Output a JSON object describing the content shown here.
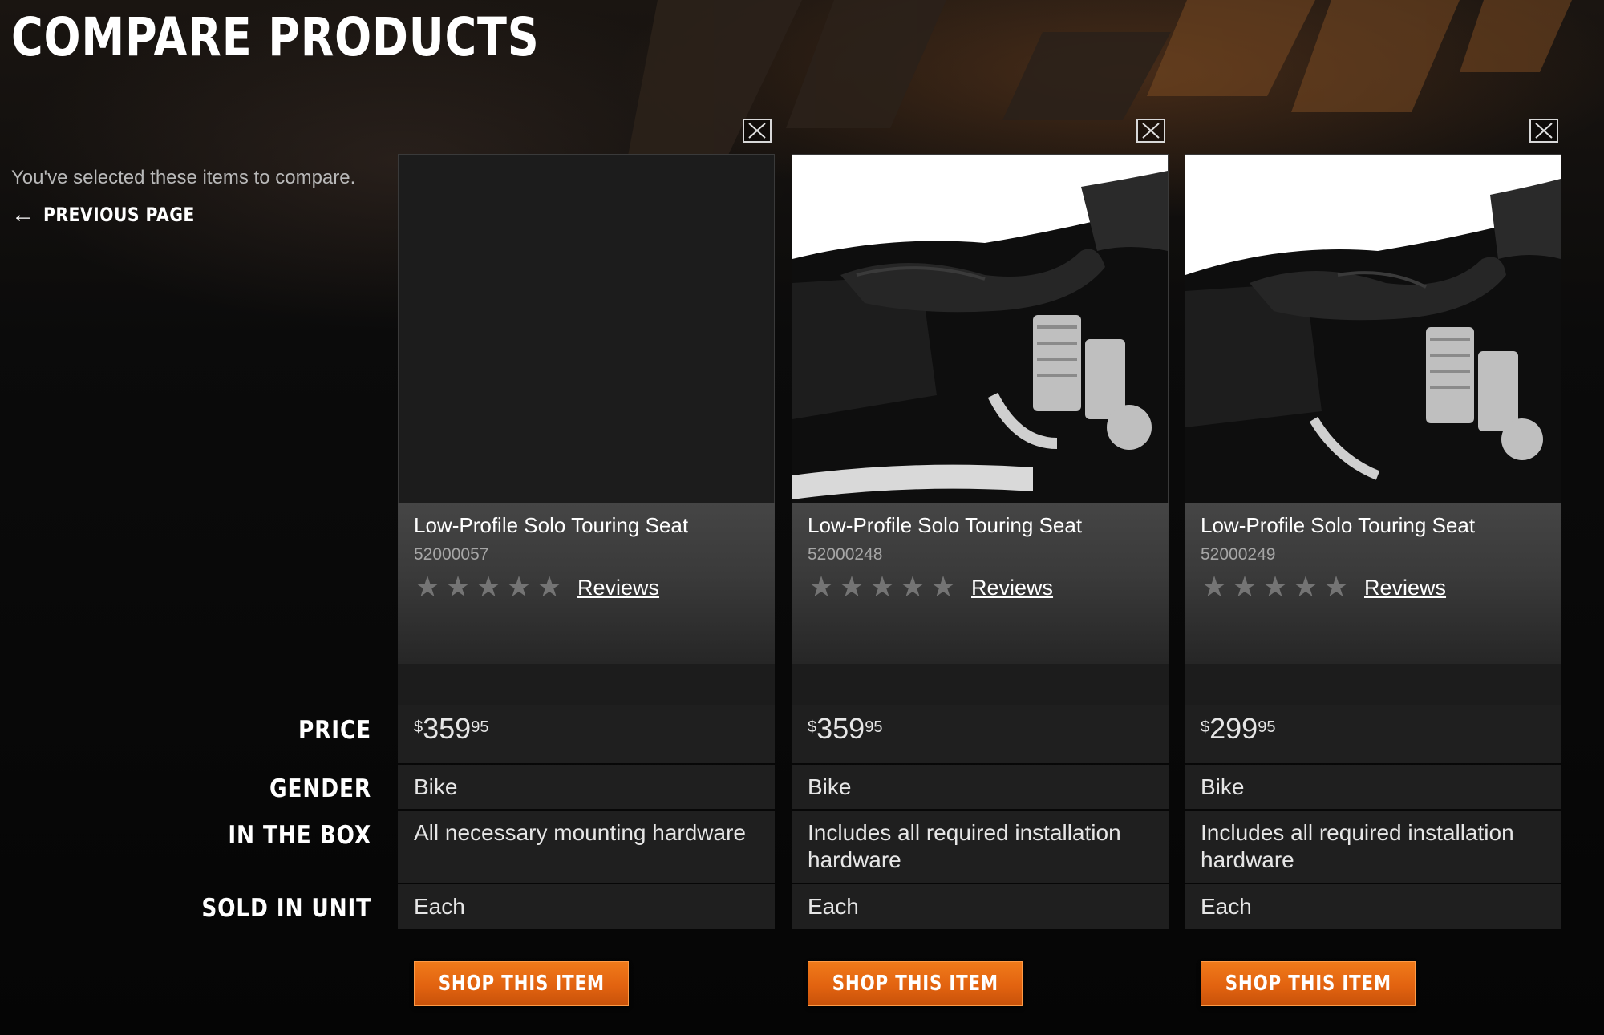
{
  "header": {
    "title": "COMPARE PRODUCTS",
    "subtitle": "You've selected these items to compare.",
    "previous_label": "PREVIOUS PAGE"
  },
  "row_labels": {
    "price": "PRICE",
    "gender": "GENDER",
    "in_the_box": "IN THE BOX",
    "sold_in_unit": "SOLD IN UNIT"
  },
  "products": [
    {
      "name": "Low-Profile Solo Touring Seat",
      "part_number": "52000057",
      "reviews_label": "Reviews",
      "rating_stars": 0,
      "price_currency": "$",
      "price_dollars": "359",
      "price_cents": "95",
      "gender": "Bike",
      "in_the_box": "All necessary mounting hardware",
      "sold_in_unit": "Each",
      "button_label": "SHOP THIS ITEM",
      "has_image": false
    },
    {
      "name": "Low-Profile Solo Touring Seat",
      "part_number": "52000248",
      "reviews_label": "Reviews",
      "rating_stars": 0,
      "price_currency": "$",
      "price_dollars": "359",
      "price_cents": "95",
      "gender": "Bike",
      "in_the_box": "Includes all required installation hardware",
      "sold_in_unit": "Each",
      "button_label": "SHOP THIS ITEM",
      "has_image": true
    },
    {
      "name": "Low-Profile Solo Touring Seat",
      "part_number": "52000249",
      "reviews_label": "Reviews",
      "rating_stars": 0,
      "price_currency": "$",
      "price_dollars": "299",
      "price_cents": "95",
      "gender": "Bike",
      "in_the_box": "Includes all required installation hardware",
      "sold_in_unit": "Each",
      "button_label": "SHOP THIS ITEM",
      "has_image": true
    }
  ],
  "icons": {
    "close": "close-icon",
    "back": "arrow-left-icon",
    "star": "star-icon"
  },
  "colors": {
    "accent": "#e26310",
    "background": "#070707",
    "panel": "#1f1f1f"
  }
}
